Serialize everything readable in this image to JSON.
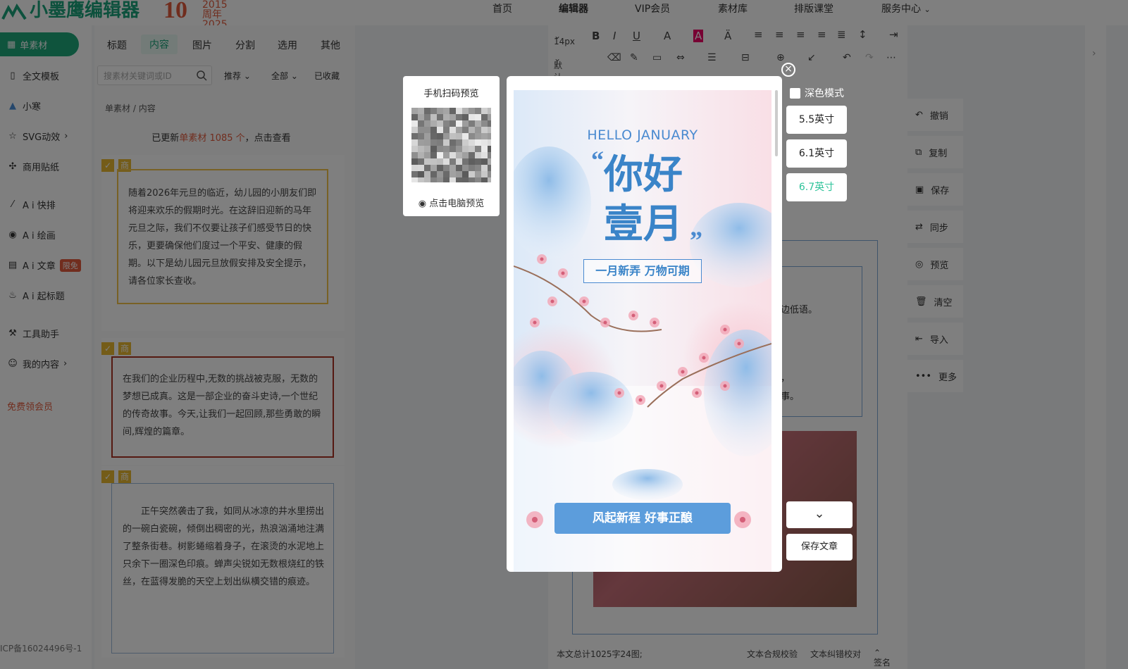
{
  "header": {
    "logo_text": "小墨鹰编辑器",
    "anniv_number": "10",
    "anniv_years": "2015",
    "anniv_label": "周年 2025",
    "nav": [
      "首页",
      "编辑器",
      "VIP会员",
      "素材库",
      "排版课堂",
      "服务中心"
    ],
    "nav_active": "编辑器"
  },
  "sidebar": {
    "primary": "单素材",
    "items": [
      "全文模板",
      "小寒",
      "SVG动效",
      "商用贴纸",
      "A i 快排",
      "A i 绘画",
      "A i 文章",
      "A i 起标题",
      "工具助手",
      "我的内容"
    ],
    "free_badge": "限免",
    "member_link": "免费领会员",
    "icp": "ICP备16024496号-1"
  },
  "panel": {
    "tabs": [
      "标题",
      "内容",
      "图片",
      "分割",
      "选用",
      "其他"
    ],
    "active_tab": "内容",
    "search_placeholder": "搜素材关键词或ID",
    "filters": [
      "推荐",
      "全部",
      "已收藏"
    ],
    "breadcrumb": [
      "单素材",
      "内容"
    ],
    "update_prefix": "已更新",
    "update_highlight": "单素材 1085 个",
    "update_suffix": "，点击查看",
    "tag_label": "商",
    "cards": [
      "随着2026年元旦的临近，幼儿园的小朋友们即将迎来欢乐的假期时光。在这辞旧迎新的马年元旦之际，我们不仅要让孩子们感受节日的快乐，更要确保他们度过一个平安、健康的假期。以下是幼儿园元旦放假安排及安全提示，请各位家长查收。",
      "在我们的企业历程中,无数的挑战被克服，无数的梦想已成真。这是一部企业的奋斗史诗,一个世纪的传奇故事。今天,让我们一起回顾,那些勇敢的瞬间,辉煌的篇章。",
      "正午突然袭击了我，如同从冰凉的井水里捞出的一碗白瓷碗，倾倒出稠密的光，热浪汹涌地注满了整条街巷。树影蜷缩着身子，在滚烫的水泥地上只余下一圈深色印痕。蝉声尖锐如无数根烧红的铁丝，在蓝得发脆的天空上划出纵横交错的痕迹。"
    ]
  },
  "editor": {
    "font_size": "14px",
    "font_family": "默认字体",
    "doc_fragments": [
      "边低语。",
      "，",
      "事。"
    ],
    "word_count": "本文总计1025字24图;",
    "footer_links": [
      "文本合规校验",
      "文本纠错校对",
      "签名"
    ]
  },
  "actions": [
    "撤销",
    "复制",
    "保存",
    "同步",
    "预览",
    "清空",
    "导入",
    "更多"
  ],
  "modal": {
    "qr_title": "手机扫码预览",
    "qr_footer": "点击电脑预览",
    "dark_mode_label": "深色模式",
    "sizes": [
      "5.5英寸",
      "6.1英寸",
      "6.7英寸"
    ],
    "active_size": "6.7英寸",
    "save_label": "保存文章"
  },
  "poster": {
    "hello": "HELLO JANUARY",
    "title_line1": "你好",
    "title_line2": "壹月",
    "open_quote": "“",
    "close_quote": "”",
    "subtitle": "一月新弄 万物可期",
    "button": "风起新程 好事正酿"
  },
  "colors": {
    "brand_green": "#1fa97b",
    "accent_red": "#e35b3d",
    "poster_blue": "#3a84c8",
    "poster_button": "#5c9ddc"
  }
}
